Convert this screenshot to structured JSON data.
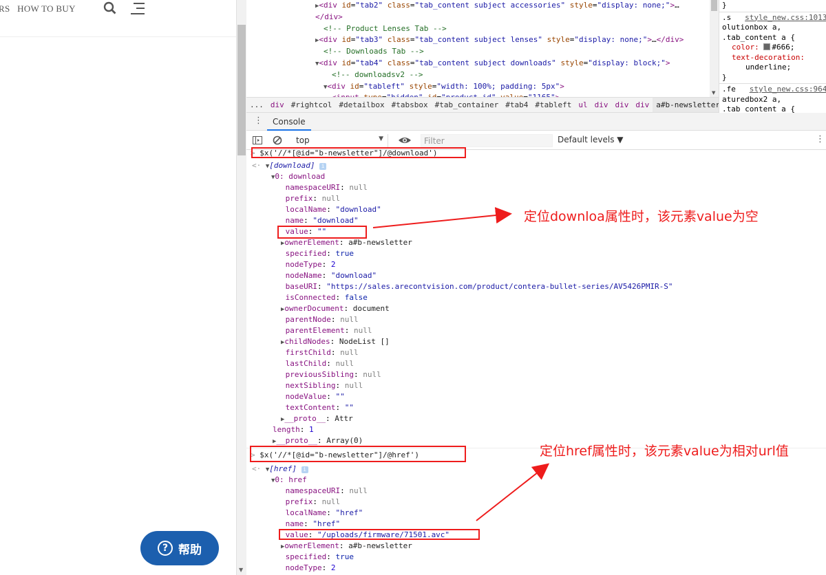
{
  "site": {
    "nav_text": "RS   HOW TO BUY",
    "help_label": "帮助",
    "help_symbol": "?"
  },
  "elements_panel": {
    "lines": [
      {
        "indent": 0,
        "html": "<span class='tri'>▶</span><span class='tag'>&lt;div</span> <span class='attr'>id</span>=<span class='val'>\"tab2\"</span> <span class='attr'>class</span>=<span class='val'>\"tab_content subject accessories\"</span> <span class='attr'>style</span>=<span class='val'>\"display: none;\"</span><span class='tag'>&gt;</span>…"
      },
      {
        "indent": 0,
        "html": "<span class='tag'>&lt;/div&gt;</span>"
      },
      {
        "indent": 1,
        "html": "<span class='cmt'>&lt;!-- Product Lenses Tab --&gt;</span>"
      },
      {
        "indent": 0,
        "html": "<span class='tri'>▶</span><span class='tag'>&lt;div</span> <span class='attr'>id</span>=<span class='val'>\"tab3\"</span> <span class='attr'>class</span>=<span class='val'>\"tab_content subject lenses\"</span> <span class='attr'>style</span>=<span class='val'>\"display: none;\"</span><span class='tag'>&gt;</span>…<span class='tag'>&lt;/div&gt;</span>"
      },
      {
        "indent": 1,
        "html": "<span class='cmt'>&lt;!-- Downloads Tab --&gt;</span>"
      },
      {
        "indent": 0,
        "html": "<span class='tri'>▼</span><span class='tag'>&lt;div</span> <span class='attr'>id</span>=<span class='val'>\"tab4\"</span> <span class='attr'>class</span>=<span class='val'>\"tab_content subject downloads\"</span> <span class='attr'>style</span>=<span class='val'>\"display: block;\"</span><span class='tag'>&gt;</span>"
      },
      {
        "indent": 2,
        "html": "<span class='cmt'>&lt;!-- downloadsv2 --&gt;</span>"
      },
      {
        "indent": 1,
        "html": "<span class='tri'>▼</span><span class='tag'>&lt;div</span> <span class='attr'>id</span>=<span class='val'>\"tableft\"</span> <span class='attr'>style</span>=<span class='val'>\"width: 100%; padding: 5px\"</span><span class='tag'>&gt;</span>"
      },
      {
        "indent": 2,
        "html": "<span class='tag'>&lt;input</span> <span class='attr'>type</span>=<span class='val'>\"hidden\"</span> <span class='attr'>id</span>=<span class='val'>\"product_id\"</span> <span class='attr'>value</span>=<span class='val'>\"1165\"</span><span class='tag'>&gt;</span>"
      }
    ]
  },
  "styles_panel": {
    "block1_line0": "}",
    "block2_src": "style_new.css:1013",
    "block2_prefix": ".s",
    "block2_sel1": "olutionbox a,",
    "block2_sel2": ".tab_content a {",
    "prop1_name": "color:",
    "prop1_val": "#666;",
    "prop2_name": "text-decoration:",
    "prop2_val": "underline;",
    "block2_close": "}",
    "block3_prefix": ".fe",
    "block3_src": "style_new.css:964",
    "block3_sel1": "aturedbox2 a,",
    "block3_sel2": ".tab_content a {"
  },
  "breadcrumb": [
    "...",
    "div",
    "#rightcol",
    "#detailbox",
    "#tabsbox",
    "#tab_container",
    "#tab4",
    "#tableft",
    "ul",
    "div",
    "div",
    "div",
    "a#b-newsletter"
  ],
  "console_tab": "Console",
  "toolbar": {
    "context": "top",
    "filter_placeholder": "Filter",
    "levels": "Default levels ▼"
  },
  "console": {
    "cmd1": "$x('//*[@id=\"b-newsletter\"]/@download')",
    "res1_label": "[download]",
    "res1_item": "0: download",
    "props1": [
      [
        "namespaceURI",
        "null",
        "null"
      ],
      [
        "prefix",
        "null",
        "null"
      ],
      [
        "localName",
        "\"download\"",
        "str2"
      ],
      [
        "name",
        "\"download\"",
        "str2"
      ],
      [
        "value",
        "\"\"",
        "str2"
      ],
      [
        "ownerElement",
        "a#b-newsletter",
        "obj"
      ],
      [
        "specified",
        "true",
        "bool"
      ],
      [
        "nodeType",
        "2",
        "num"
      ],
      [
        "nodeName",
        "\"download\"",
        "str2"
      ],
      [
        "baseURI",
        "\"https://sales.arecontvision.com/product/contera-bullet-series/AV5426PMIR-S\"",
        "str2"
      ],
      [
        "isConnected",
        "false",
        "bool"
      ],
      [
        "ownerDocument",
        "document",
        "obj"
      ],
      [
        "parentNode",
        "null",
        "null"
      ],
      [
        "parentElement",
        "null",
        "null"
      ],
      [
        "childNodes",
        "NodeList []",
        "obj"
      ],
      [
        "firstChild",
        "null",
        "null"
      ],
      [
        "lastChild",
        "null",
        "null"
      ],
      [
        "previousSibling",
        "null",
        "null"
      ],
      [
        "nextSibling",
        "null",
        "null"
      ],
      [
        "nodeValue",
        "\"\"",
        "str2"
      ],
      [
        "textContent",
        "\"\"",
        "str2"
      ],
      [
        "__proto__",
        "Attr",
        "obj"
      ]
    ],
    "length1": "length: 1",
    "proto1": "__proto__: Array(0)",
    "cmd2": "$x('//*[@id=\"b-newsletter\"]/@href')",
    "res2_label": "[href]",
    "res2_item": "0: href",
    "props2": [
      [
        "namespaceURI",
        "null",
        "null"
      ],
      [
        "prefix",
        "null",
        "null"
      ],
      [
        "localName",
        "\"href\"",
        "str2"
      ],
      [
        "name",
        "\"href\"",
        "str2"
      ],
      [
        "value",
        "\"/uploads/firmware/71501.avc\"",
        "str2"
      ],
      [
        "ownerElement",
        "a#b-newsletter",
        "obj"
      ],
      [
        "specified",
        "true",
        "bool"
      ],
      [
        "nodeType",
        "2",
        "num"
      ]
    ]
  },
  "annotations": {
    "note1": "定位downloa属性时，该元素value为空",
    "note2": "定位href属性时，该元素value为相对url值"
  },
  "colors": {
    "annotation_red": "#ee1c1c",
    "help_blue": "#1c5fae"
  }
}
